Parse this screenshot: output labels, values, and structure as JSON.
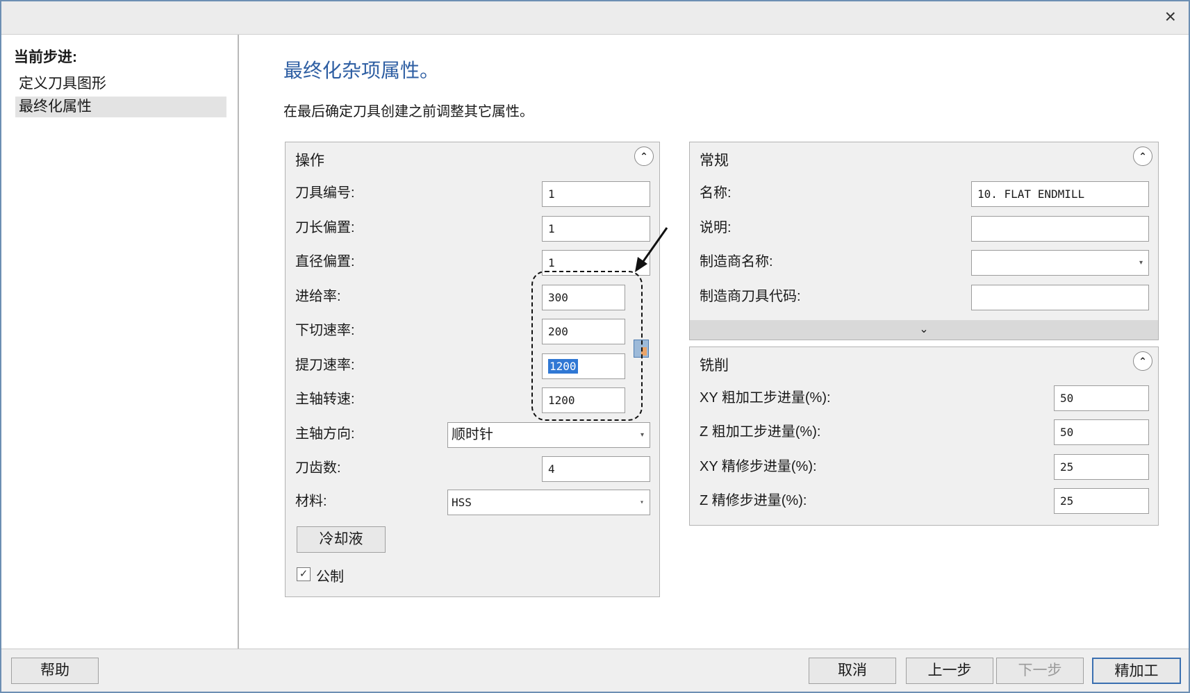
{
  "window": {
    "close_glyph": "×"
  },
  "steps": {
    "heading": "当前步进:",
    "items": [
      {
        "label": "定义刀具图形",
        "active": false
      },
      {
        "label": "最终化属性",
        "active": true
      }
    ]
  },
  "main": {
    "title": "最终化杂项属性。",
    "description": "在最后确定刀具创建之前调整其它属性。"
  },
  "ops_panel": {
    "header": "操作",
    "collapse_glyph": "⌃",
    "fields": {
      "tool_number": {
        "label": "刀具编号:",
        "value": "1"
      },
      "length_offset": {
        "label": "刀长偏置:",
        "value": "1"
      },
      "diameter_offset": {
        "label": "直径偏置:",
        "value": "1"
      },
      "feed_rate": {
        "label": "进给率:",
        "value": "300"
      },
      "plunge_rate": {
        "label": "下切速率:",
        "value": "200"
      },
      "retract_rate": {
        "label": "提刀速率:",
        "value": "1200"
      },
      "spindle_speed": {
        "label": "主轴转速:",
        "value": "1200"
      },
      "spindle_direction": {
        "label": "主轴方向:",
        "value": "顺时针"
      },
      "flutes": {
        "label": "刀齿数:",
        "value": "4"
      },
      "material": {
        "label": "材料:",
        "value": "HSS"
      }
    },
    "coolant_button": "冷却液",
    "metric": {
      "label": "公制",
      "checked": true,
      "check_glyph": "✓"
    }
  },
  "general_panel": {
    "header": "常规",
    "collapse_glyph": "⌃",
    "fields": {
      "name": {
        "label": "名称:",
        "value": "10. FLAT ENDMILL"
      },
      "description": {
        "label": "说明:",
        "value": ""
      },
      "manufacturer": {
        "label": "制造商名称:",
        "value": ""
      },
      "manufacturer_code": {
        "label": "制造商刀具代码:",
        "value": ""
      }
    },
    "expand_glyph": "⌄"
  },
  "milling_panel": {
    "header": "铣削",
    "collapse_glyph": "⌃",
    "fields": {
      "xy_rough": {
        "label": "XY 粗加工步进量(%):",
        "value": "50"
      },
      "z_rough": {
        "label": "Z 粗加工步进量(%):",
        "value": "50"
      },
      "xy_finish": {
        "label": "XY 精修步进量(%):",
        "value": "25"
      },
      "z_finish": {
        "label": "Z 精修步进量(%):",
        "value": "25"
      }
    }
  },
  "footer": {
    "help": "帮助",
    "cancel": "取消",
    "back": "上一步",
    "next": "下一步",
    "finish": "精加工"
  }
}
